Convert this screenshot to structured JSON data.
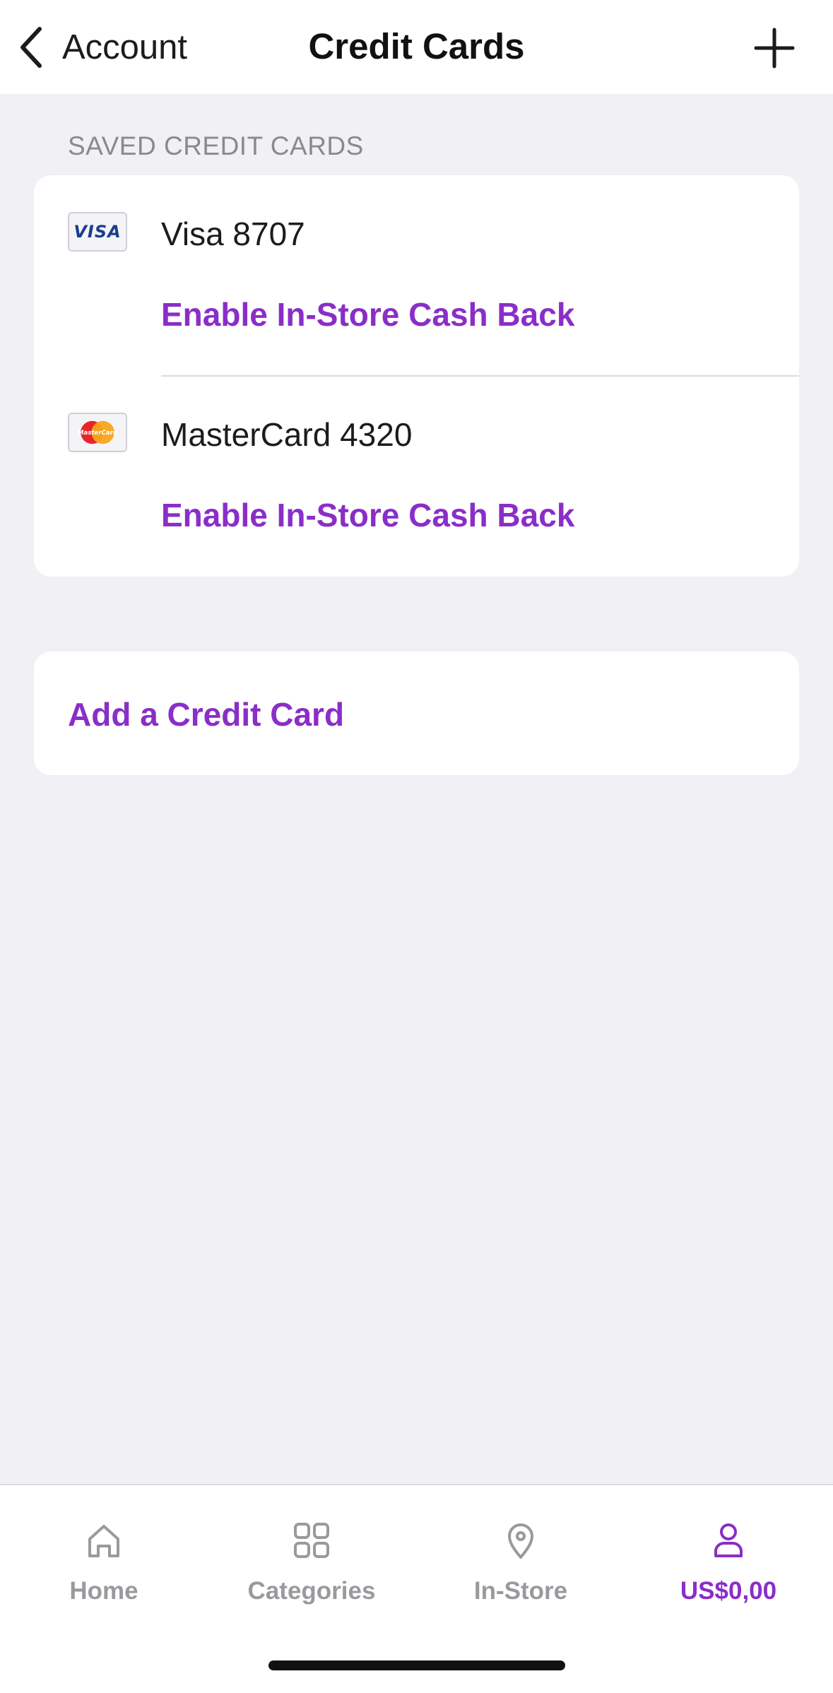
{
  "header": {
    "back_label": "Account",
    "title": "Credit Cards"
  },
  "section_label": "SAVED CREDIT CARDS",
  "cards": [
    {
      "name": "Visa 8707",
      "logo_text": "VISA",
      "action": "Enable In-Store Cash Back"
    },
    {
      "name": "MasterCard 4320",
      "logo_text": "MasterCard",
      "action": "Enable In-Store Cash Back"
    }
  ],
  "add_card_label": "Add a Credit Card",
  "tabs": [
    {
      "label": "Home",
      "icon": "home-icon"
    },
    {
      "label": "Categories",
      "icon": "grid-icon"
    },
    {
      "label": "In-Store",
      "icon": "location-pin-icon"
    },
    {
      "label": "US$0,00",
      "icon": "person-icon",
      "active": true
    }
  ],
  "colors": {
    "accent": "#8a2ec8",
    "background": "#f0f0f5",
    "inactive_tab": "#9a9a9e"
  }
}
